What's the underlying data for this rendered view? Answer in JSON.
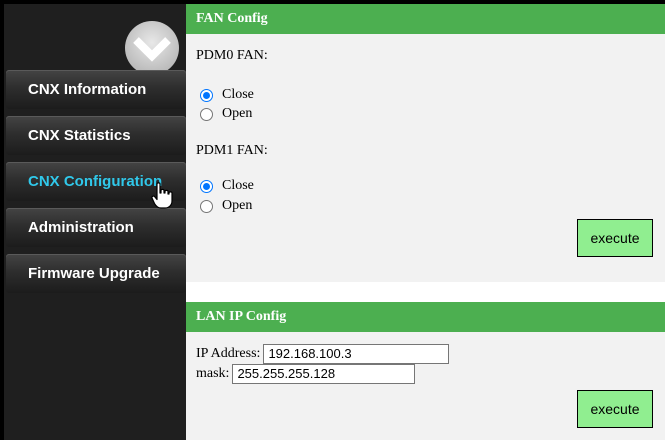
{
  "sidebar": {
    "logo_icon": "chevron-down-circle-icon",
    "items": [
      {
        "label": "CNX Information"
      },
      {
        "label": "CNX Statistics"
      },
      {
        "label": "CNX Configuration"
      },
      {
        "label": "Administration"
      },
      {
        "label": "Firmware Upgrade"
      }
    ],
    "active_item": "CNX Configuration"
  },
  "fan_config": {
    "title": "FAN Config",
    "pdm0": {
      "label": "PDM0 FAN:",
      "options": [
        "Close",
        "Open"
      ],
      "selected": "Close"
    },
    "pdm1": {
      "label": "PDM1 FAN:",
      "options": [
        "Close",
        "Open"
      ],
      "selected": "Close"
    },
    "execute_label": "execute"
  },
  "lan_config": {
    "title": "LAN IP Config",
    "ip_label": "IP Address:",
    "ip_value": "192.168.100.3",
    "mask_label": "mask:",
    "mask_value": "255.255.255.128",
    "execute_label": "execute"
  },
  "colors": {
    "header_green": "#4caf50",
    "button_green": "#90ee90",
    "active_menu": "#30c8ea",
    "sidebar_bg": "#1f1f1f"
  }
}
